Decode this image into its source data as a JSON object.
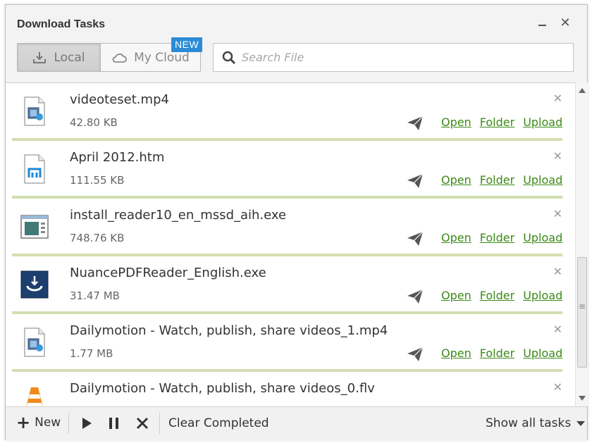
{
  "window": {
    "title": "Download Tasks"
  },
  "tabs": {
    "local": "Local",
    "cloud": "My Cloud",
    "badge": "NEW"
  },
  "search": {
    "placeholder": "Search File"
  },
  "colors": {
    "accent": "#3b8a17",
    "progress": "#d2deb0",
    "badge": "#2a8cd8"
  },
  "items": [
    {
      "name": "videoteset.mp4",
      "size": "42.80 KB",
      "icon": "video-file-icon"
    },
    {
      "name": "April 2012.htm",
      "size": "111.55 KB",
      "icon": "maxthon-file-icon"
    },
    {
      "name": "install_reader10_en_mssd_aih.exe",
      "size": "748.76 KB",
      "icon": "installer-file-icon"
    },
    {
      "name": "NuancePDFReader_English.exe",
      "size": "31.47 MB",
      "icon": "nuance-app-icon"
    },
    {
      "name": "Dailymotion - Watch, publish, share videos_1.mp4",
      "size": "1.77 MB",
      "icon": "video-file-icon"
    },
    {
      "name": "Dailymotion - Watch, publish, share videos_0.flv",
      "size": "",
      "icon": "vlc-cone-icon"
    }
  ],
  "actions": {
    "open": "Open",
    "folder": "Folder",
    "upload": "Upload"
  },
  "bottom": {
    "new": "New",
    "clear": "Clear Completed",
    "show": "Show all tasks"
  }
}
